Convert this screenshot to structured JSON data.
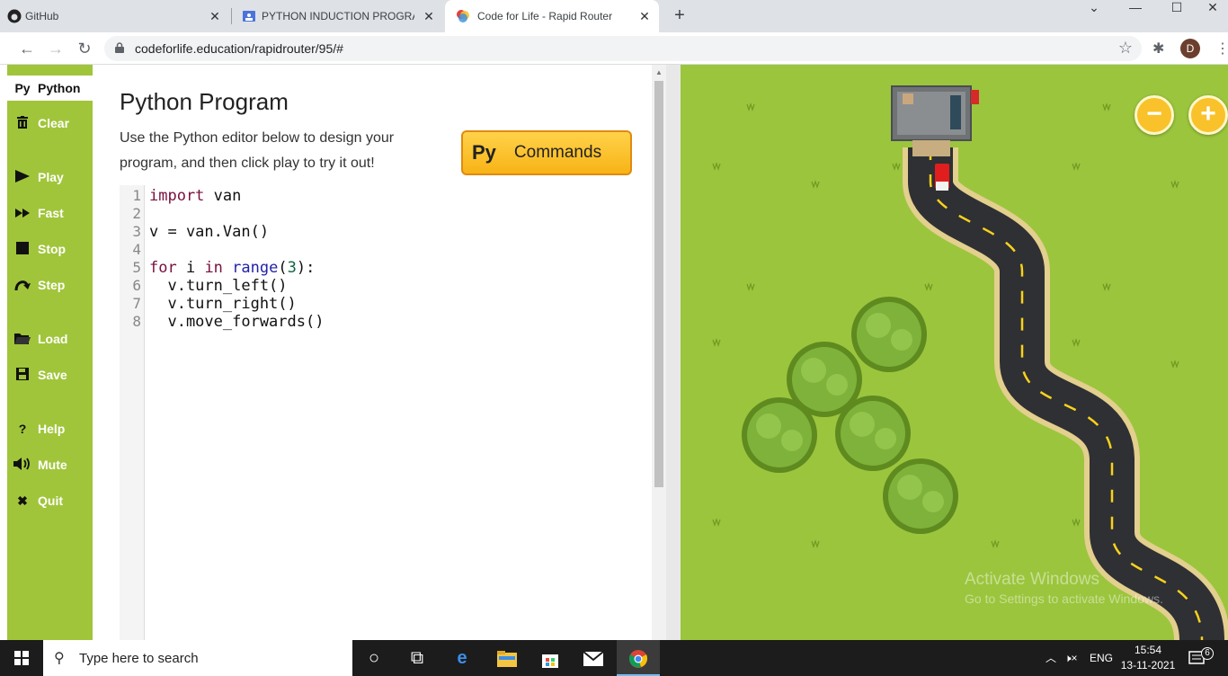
{
  "browser": {
    "tabs": [
      {
        "title": "GitHub",
        "active": false
      },
      {
        "title": "PYTHON INDUCTION PROGRAM",
        "active": false
      },
      {
        "title": "Code for Life - Rapid Router",
        "active": true
      }
    ],
    "new_tab_symbol": "+",
    "url": "codeforlife.education/rapidrouter/95/#",
    "profile_initial": "D"
  },
  "sidebar": {
    "items": [
      {
        "label": "Python",
        "icon": "python-icon",
        "glyph": "Py"
      },
      {
        "label": "Clear",
        "icon": "trash-icon",
        "glyph": "🗑"
      },
      {
        "label": "Play",
        "icon": "play-icon",
        "glyph": "▶"
      },
      {
        "label": "Fast",
        "icon": "fast-forward-icon",
        "glyph": "▶▶"
      },
      {
        "label": "Stop",
        "icon": "stop-icon",
        "glyph": "■"
      },
      {
        "label": "Step",
        "icon": "step-icon",
        "glyph": "↷"
      },
      {
        "label": "Load",
        "icon": "folder-icon",
        "glyph": "📂"
      },
      {
        "label": "Save",
        "icon": "save-icon",
        "glyph": "💾"
      },
      {
        "label": "Help",
        "icon": "help-icon",
        "glyph": "?"
      },
      {
        "label": "Mute",
        "icon": "speaker-icon",
        "glyph": "🔊"
      },
      {
        "label": "Quit",
        "icon": "close-icon",
        "glyph": "✖"
      }
    ]
  },
  "editor": {
    "title": "Python Program",
    "intro": "Use the Python editor below to design your program, and then click play to try it out!",
    "commands_button": {
      "prefix": "Py",
      "label": "Commands"
    },
    "line_numbers": [
      "1",
      "2",
      "3",
      "4",
      "5",
      "6",
      "7",
      "8"
    ]
  },
  "game": {
    "zoom_out": "−",
    "zoom_in": "+",
    "watermark_line1": "Activate Windows",
    "watermark_line2": "Go to Settings to activate Windows."
  },
  "taskbar": {
    "search_placeholder": "Type here to search",
    "language": "ENG",
    "time": "15:54",
    "date": "13-11-2021",
    "notification_count": "6"
  }
}
